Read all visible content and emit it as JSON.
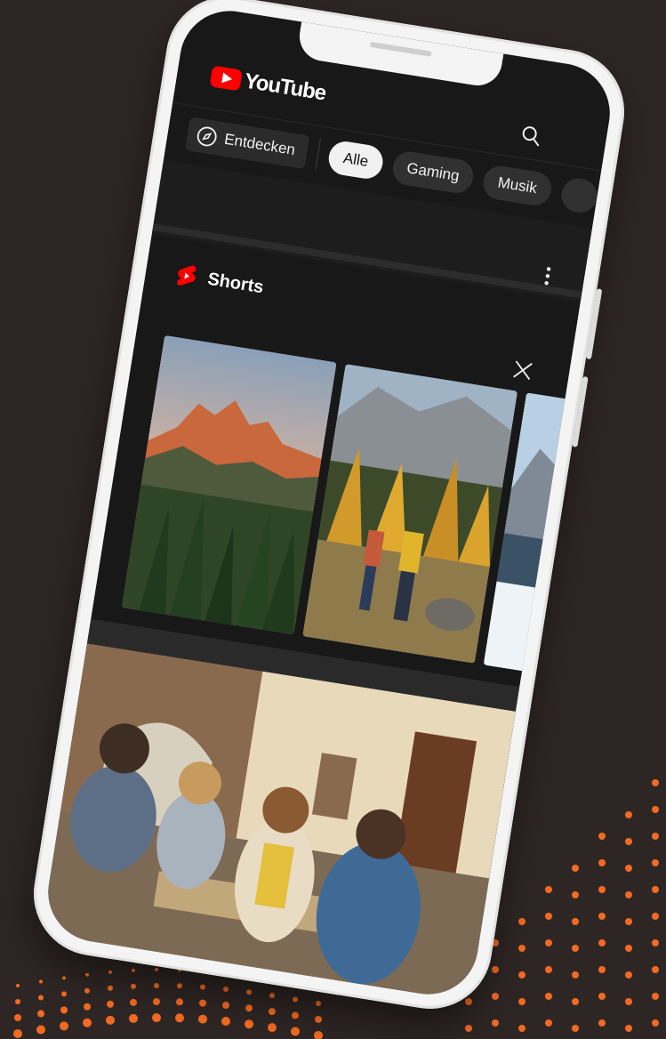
{
  "app": {
    "logo_text": "YouTube"
  },
  "chips": {
    "explore_label": "Entdecken",
    "items": [
      {
        "label": "Alle",
        "active": true
      },
      {
        "label": "Gaming",
        "active": false
      },
      {
        "label": "Musik",
        "active": false
      }
    ]
  },
  "shorts": {
    "section_title": "Shorts"
  },
  "icons": {
    "search": "search-icon",
    "compass": "compass-icon",
    "more": "more-vert-icon",
    "shorts": "shorts-icon",
    "close": "close-icon"
  },
  "colors": {
    "brand_red": "#ff0000",
    "background": "#2e2624",
    "screen": "#181818",
    "accent_orange": "#f26a21"
  }
}
